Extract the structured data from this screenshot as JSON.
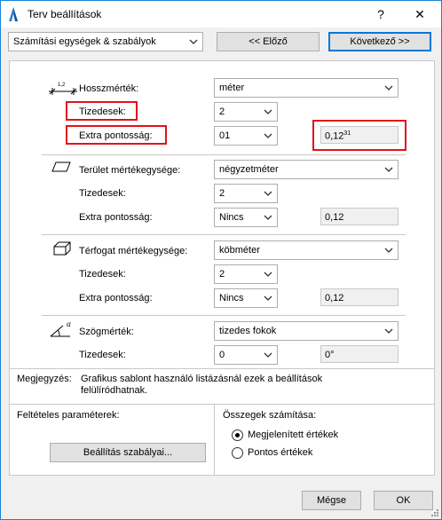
{
  "window": {
    "title": "Terv beállítások",
    "help_label": "?",
    "close_label": "✕"
  },
  "top": {
    "category_select": "Számítási egységek & szabályok",
    "prev_label": "<< Előző",
    "next_label": "Következő >>"
  },
  "length": {
    "label": "Hosszmérték:",
    "unit": "méter",
    "decimals_label": "Tizedesek:",
    "decimals_value": "2",
    "extra_label": "Extra pontosság:",
    "extra_value": "01",
    "preview_main": "0,12",
    "preview_sup": "31",
    "icon_caption": "1,2"
  },
  "area": {
    "label": "Terület mértékegysége:",
    "unit": "négyzetméter",
    "decimals_label": "Tizedesek:",
    "decimals_value": "2",
    "extra_label": "Extra pontosság:",
    "extra_value": "Nincs",
    "preview": "0,12"
  },
  "volume": {
    "label": "Térfogat mértékegysége:",
    "unit": "köbméter",
    "decimals_label": "Tizedesek:",
    "decimals_value": "2",
    "extra_label": "Extra pontosság:",
    "extra_value": "Nincs",
    "preview": "0,12"
  },
  "angle": {
    "label": "Szögmérték:",
    "unit": "tizedes fokok",
    "decimals_label": "Tizedesek:",
    "decimals_value": "0",
    "preview": "0°",
    "icon_caption": "α"
  },
  "note": {
    "label": "Megjegyzés:",
    "line1": "Grafikus sablont használó listázásnál ezek a beállítások",
    "line2": "felülíródhatnak."
  },
  "conditional": {
    "label": "Feltételes paraméterek:",
    "button": "Beállítás szabályai..."
  },
  "totals": {
    "label": "Összegek számítása:",
    "options": [
      {
        "label": "Megjelenített értékek",
        "selected": true
      },
      {
        "label": "Pontos értékek",
        "selected": false
      }
    ]
  },
  "footer": {
    "cancel_label": "Mégse",
    "ok_label": "OK"
  },
  "colors": {
    "highlight": "#e0131b",
    "accent": "#0078d7"
  }
}
